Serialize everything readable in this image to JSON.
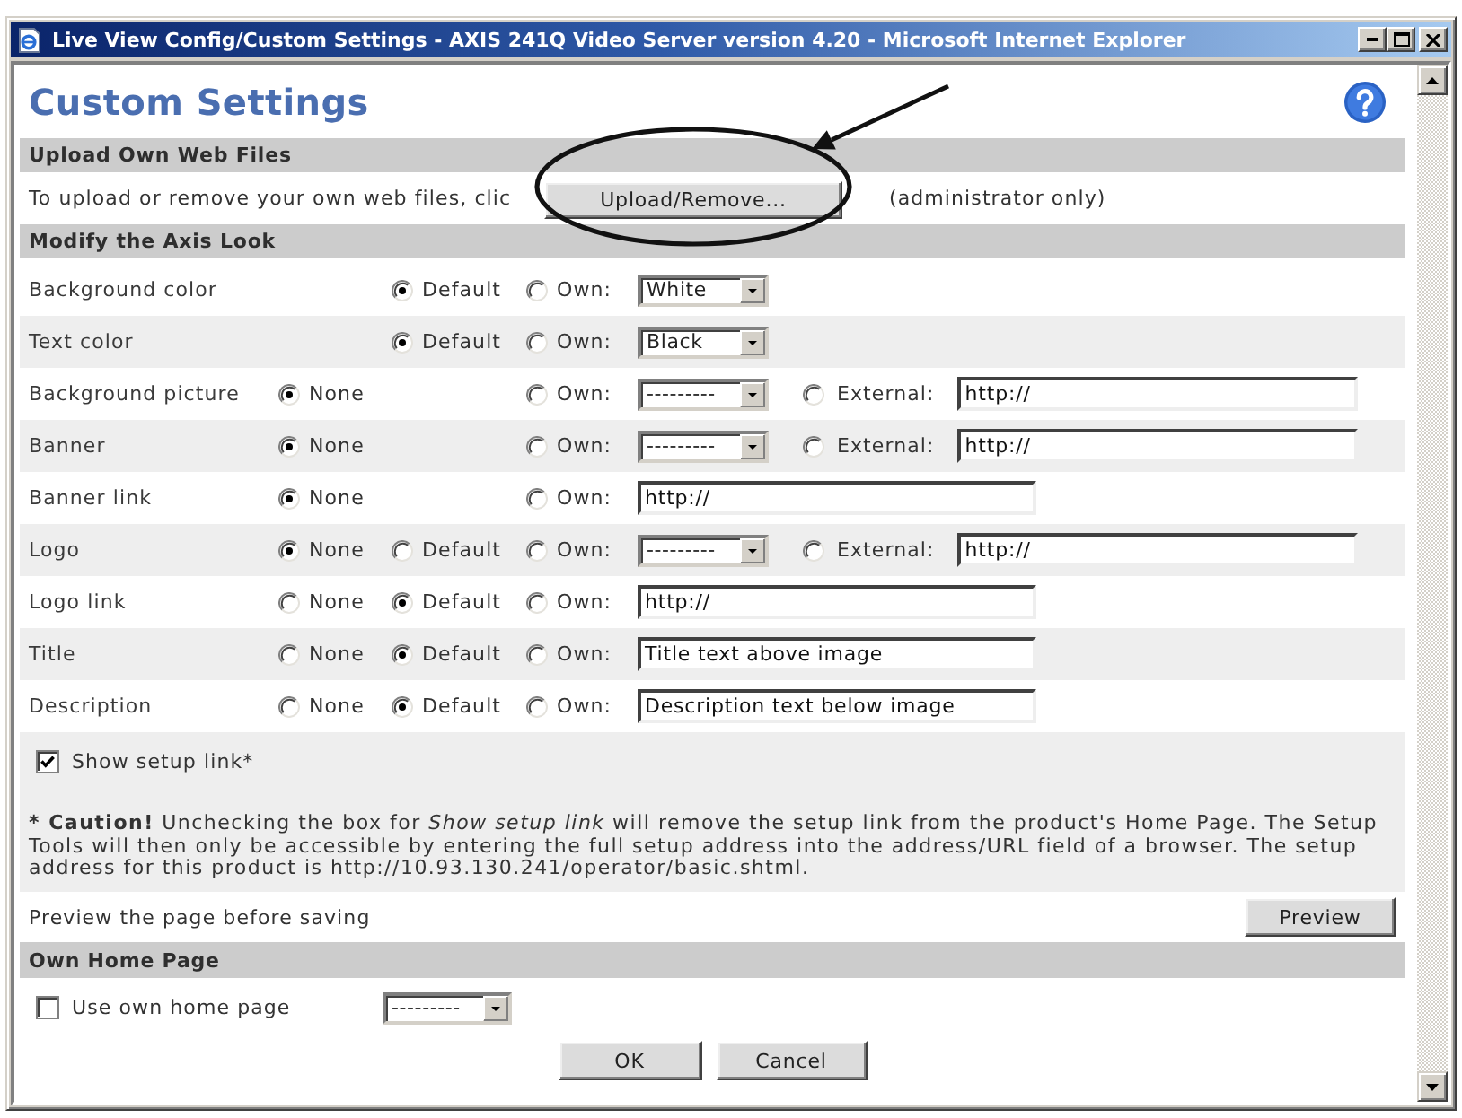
{
  "window": {
    "title": "Live View Config/Custom Settings - AXIS 241Q Video Server version 4.20 - Microsoft Internet Explorer"
  },
  "page": {
    "heading": "Custom Settings"
  },
  "upload": {
    "title": "Upload Own Web Files",
    "text": "To upload or remove your own web files, clic",
    "button": "Upload/Remove...",
    "note": "(administrator only)"
  },
  "look": {
    "title": "Modify the Axis Look",
    "rows": [
      {
        "label": "Background color",
        "default": {
          "label": "Default",
          "selected": true
        },
        "own": {
          "label": "Own:",
          "selected": false
        },
        "own_field": {
          "kind": "select",
          "value": "White"
        }
      },
      {
        "label": "Text color",
        "default": {
          "label": "Default",
          "selected": true
        },
        "own": {
          "label": "Own:",
          "selected": false
        },
        "own_field": {
          "kind": "select",
          "value": "Black"
        }
      },
      {
        "label": "Background picture",
        "none": {
          "label": "None",
          "selected": true
        },
        "own": {
          "label": "Own:",
          "selected": false
        },
        "own_field": {
          "kind": "select",
          "value": "---------"
        },
        "external": {
          "label": "External:",
          "selected": false,
          "value": "http://"
        }
      },
      {
        "label": "Banner",
        "none": {
          "label": "None",
          "selected": true
        },
        "own": {
          "label": "Own:",
          "selected": false
        },
        "own_field": {
          "kind": "select",
          "value": "---------"
        },
        "external": {
          "label": "External:",
          "selected": false,
          "value": "http://"
        }
      },
      {
        "label": "Banner link",
        "none": {
          "label": "None",
          "selected": true
        },
        "own": {
          "label": "Own:",
          "selected": false
        },
        "own_field": {
          "kind": "input",
          "value": "http://"
        }
      },
      {
        "label": "Logo",
        "none": {
          "label": "None",
          "selected": true
        },
        "default": {
          "label": "Default",
          "selected": false
        },
        "own": {
          "label": "Own:",
          "selected": false
        },
        "own_field": {
          "kind": "select",
          "value": "---------"
        },
        "external": {
          "label": "External:",
          "selected": false,
          "value": "http://"
        }
      },
      {
        "label": "Logo link",
        "none": {
          "label": "None",
          "selected": false
        },
        "default": {
          "label": "Default",
          "selected": true
        },
        "own": {
          "label": "Own:",
          "selected": false
        },
        "own_field": {
          "kind": "input",
          "value": "http://"
        }
      },
      {
        "label": "Title",
        "none": {
          "label": "None",
          "selected": false
        },
        "default": {
          "label": "Default",
          "selected": true
        },
        "own": {
          "label": "Own:",
          "selected": false
        },
        "own_field": {
          "kind": "input",
          "value": "Title text above image"
        }
      },
      {
        "label": "Description",
        "none": {
          "label": "None",
          "selected": false
        },
        "default": {
          "label": "Default",
          "selected": true
        },
        "own": {
          "label": "Own:",
          "selected": false
        },
        "own_field": {
          "kind": "input",
          "value": "Description text below image"
        }
      }
    ],
    "show_setup_link": {
      "label": "Show setup link*",
      "checked": true
    },
    "caution": {
      "lead": "* Caution!",
      "text": "Unchecking the box for *Show setup link* will remove the setup link from the product's Home Page. The Setup Tools will then only be accessible by entering the full setup address into the address/URL field of a browser. The setup address for this product is http://10.93.130.241/operator/basic.shtml."
    },
    "preview": {
      "text": "Preview the page before saving",
      "button": "Preview"
    }
  },
  "home": {
    "title": "Own Home Page",
    "checkbox": {
      "label": "Use own home page",
      "checked": false
    },
    "select": "---------"
  },
  "buttons": [
    "OK",
    "Cancel"
  ]
}
